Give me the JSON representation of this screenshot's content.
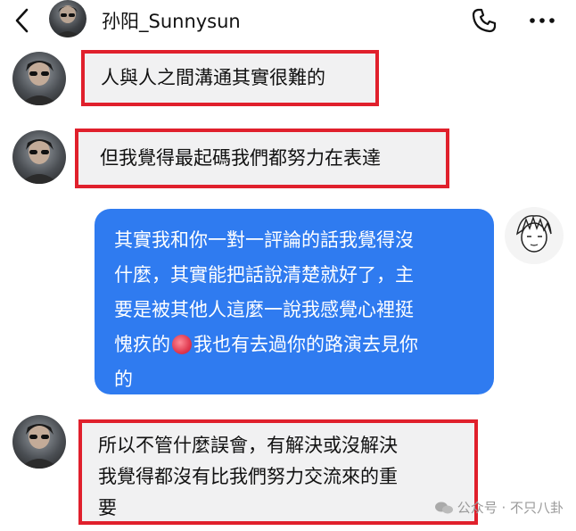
{
  "header": {
    "contact_name": "孙阳_Sunnysun",
    "back_icon": "chevron-left-icon",
    "call_icon": "phone-icon",
    "more_icon": "more-horizontal-icon"
  },
  "messages": [
    {
      "side": "incoming",
      "text": "人與人之間溝通其實很難的",
      "highlighted": true
    },
    {
      "side": "incoming",
      "text": "但我覺得最起碼我們都努力在表達",
      "highlighted": true
    },
    {
      "side": "outgoing",
      "lines": [
        "其實我和你一對一評論的話我覺得沒",
        "什麼，其實能把話說清楚就好了，主",
        "要是被其他人這麼一說我感覺心裡挺",
        "愧疚的",
        "我也有去過你的路演去見你",
        "的"
      ],
      "emoji": "peach-emoji",
      "highlighted": false
    },
    {
      "side": "incoming",
      "lines": [
        "所以不管什麼誤會，有解決或沒解決",
        "我覺得都沒有比我們努力交流來的重",
        "要"
      ],
      "highlighted": true
    }
  ],
  "watermark": {
    "text": "公众号 · 不只八卦",
    "icon": "wechat-icon"
  },
  "colors": {
    "outgoing_bubble": "#2f7bf0",
    "incoming_bubble": "#f1f1f2",
    "highlight_border": "#e0202c"
  }
}
